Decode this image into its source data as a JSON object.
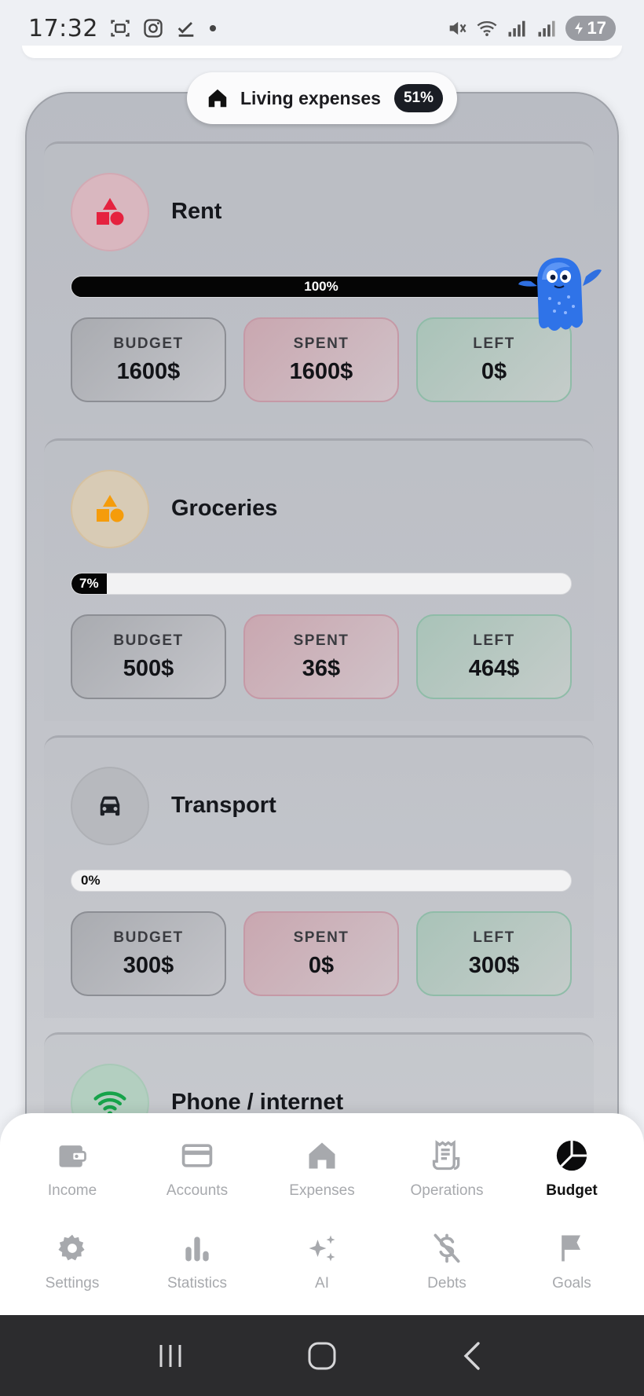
{
  "status_bar": {
    "time": "17:32",
    "battery": "17",
    "icons": [
      "screenshot-icon",
      "instagram-icon",
      "checkmark-icon",
      "dot-icon",
      "mute-icon",
      "wifi-icon",
      "signal-icon",
      "signal-icon-2",
      "battery-icon"
    ]
  },
  "header": {
    "icon": "home-icon",
    "title": "Living expenses",
    "percent": "51%"
  },
  "categories": [
    {
      "name": "Rent",
      "icon": "shapes-icon",
      "icon_color": "#e5223f",
      "progress_label": "100%",
      "progress_fraction": 1.0,
      "budget_label": "BUDGET",
      "budget": "1600$",
      "spent_label": "SPENT",
      "spent": "1600$",
      "left_label": "LEFT",
      "left": "0$"
    },
    {
      "name": "Groceries",
      "icon": "shapes-icon",
      "icon_color": "#f59c0b",
      "progress_label": "7%",
      "progress_fraction": 0.07,
      "budget_label": "BUDGET",
      "budget": "500$",
      "spent_label": "SPENT",
      "spent": "36$",
      "left_label": "LEFT",
      "left": "464$"
    },
    {
      "name": "Transport",
      "icon": "car-icon",
      "icon_color": "#1d2026",
      "progress_label": "0%",
      "progress_fraction": 0.0,
      "budget_label": "BUDGET",
      "budget": "300$",
      "spent_label": "SPENT",
      "spent": "0$",
      "left_label": "LEFT",
      "left": "300$"
    },
    {
      "name": "Phone / internet",
      "icon": "wifi-icon",
      "icon_color": "#16a34a"
    }
  ],
  "nav": {
    "row1": [
      {
        "label": "Income",
        "icon": "wallet-icon",
        "active": false
      },
      {
        "label": "Accounts",
        "icon": "credit-card-icon",
        "active": false
      },
      {
        "label": "Expenses",
        "icon": "home-icon",
        "active": false
      },
      {
        "label": "Operations",
        "icon": "receipt-icon",
        "active": false
      },
      {
        "label": "Budget",
        "icon": "pie-chart-icon",
        "active": true
      }
    ],
    "row2": [
      {
        "label": "Settings",
        "icon": "gear-icon",
        "active": false
      },
      {
        "label": "Statistics",
        "icon": "bar-chart-icon",
        "active": false
      },
      {
        "label": "AI",
        "icon": "sparkles-icon",
        "active": false
      },
      {
        "label": "Debts",
        "icon": "dollar-off-icon",
        "active": false
      },
      {
        "label": "Goals",
        "icon": "flag-icon",
        "active": false
      }
    ]
  },
  "colors": {
    "accent": "#050505",
    "muted_nav": "#a7a9ad",
    "rent_icon": "#e5223f",
    "groceries_icon": "#f59c0b",
    "phone_icon": "#16a34a"
  }
}
